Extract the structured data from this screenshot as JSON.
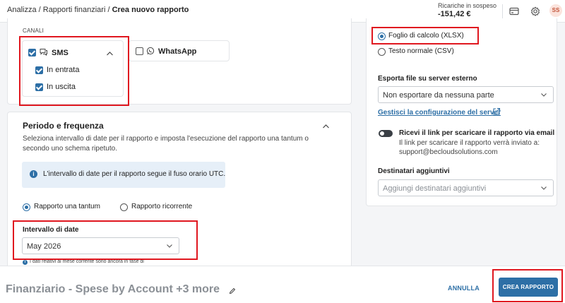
{
  "header": {
    "breadcrumb": [
      {
        "label": "Analizza"
      },
      {
        "label": "Rapporti finanziari"
      },
      {
        "label": "Crea nuovo rapporto"
      }
    ],
    "separator": " / ",
    "balance": {
      "label": "Ricariche in sospeso",
      "value": "-151,42 €"
    },
    "avatar_initials": "SS",
    "icons": [
      "card-icon",
      "gear-icon"
    ]
  },
  "channels": {
    "title": "CANALI",
    "sms": {
      "label": "SMS",
      "checked": true,
      "expanded": true,
      "options": [
        {
          "label": "In entrata",
          "checked": true
        },
        {
          "label": "In uscita",
          "checked": true
        }
      ]
    },
    "whatsapp": {
      "label": "WhatsApp",
      "checked": false
    }
  },
  "period": {
    "title": "Periodo e frequenza",
    "description": "Seleziona intervallo di date per il rapporto e imposta l'esecuzione del rapporto una tantum o secondo uno schema ripetuto.",
    "info": "L'intervallo di date per il rapporto segue il fuso orario UTC.",
    "options": [
      {
        "label": "Rapporto una tantum",
        "selected": true
      },
      {
        "label": "Rapporto ricorrente",
        "selected": false
      }
    ],
    "date_range": {
      "label": "Intervallo di date",
      "value": "May 2026"
    },
    "note": "I dati relativi al mese corrente sono ancora in fase di"
  },
  "format": {
    "options": [
      {
        "label": "Foglio di calcolo (XLSX)",
        "selected": true
      },
      {
        "label": "Testo normale (CSV)",
        "selected": false
      }
    ]
  },
  "export": {
    "label": "Esporta file su server esterno",
    "value": "Non esportare da nessuna parte",
    "manage_link": "Gestisci la configurazione del server"
  },
  "email_link": {
    "title": "Ricevi il link per scaricare il rapporto via email",
    "description": "Il link per scaricare il rapporto verrà inviato a:",
    "email": "support@becloudsolutions.com",
    "enabled": false
  },
  "recipients": {
    "label": "Destinatari aggiuntivi",
    "placeholder": "Aggiungi destinatari aggiuntivi"
  },
  "footer": {
    "report_name": "Finanziario - Spese by Account +3 more",
    "cancel_label": "ANNULLA",
    "create_label": "CREA RAPPORTO"
  },
  "colors": {
    "accent": "#2d6fa6",
    "highlight": "#e0171f"
  }
}
